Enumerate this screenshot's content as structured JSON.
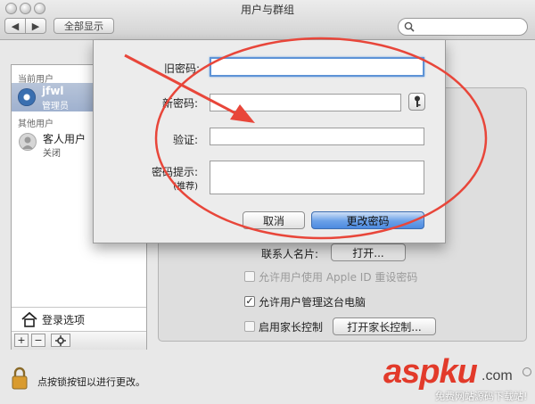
{
  "window": {
    "title": "用户与群组"
  },
  "toolbar": {
    "back_label": "◀",
    "forward_label": "▶",
    "show_all_label": "全部显示"
  },
  "sidebar": {
    "current_header": "当前用户",
    "current_user": {
      "name": "jfwl",
      "role": "管理员"
    },
    "other_header": "其他用户",
    "guest_user": {
      "name": "客人用户",
      "status": "关闭"
    },
    "login_options": "登录选项",
    "add_label": "+",
    "remove_label": "−"
  },
  "panel": {
    "contact_card_label": "联系人名片:",
    "open_button": "打开...",
    "allow_apple_id": "允许用户使用 Apple ID 重设密码",
    "allow_admin": "允许用户管理这台电脑",
    "enable_parental": "启用家长控制",
    "open_parental_button": "打开家长控制...",
    "allow_admin_checked": true
  },
  "sheet": {
    "old_password_label": "旧密码:",
    "new_password_label": "新密码:",
    "verify_label": "验证:",
    "hint_label": "密码提示:",
    "hint_sub_label": "(推荐)",
    "key_icon": "key-icon",
    "cancel_button": "取消",
    "change_button": "更改密码"
  },
  "footer": {
    "lock_text": "点按锁按钮以进行更改。"
  },
  "watermark": {
    "brand": "aspku",
    "tld": ".com",
    "tagline": "免费网站源码下载站!"
  },
  "annotation": {
    "arrow_color": "#e8463a",
    "ellipse_color": "#e8463a"
  }
}
